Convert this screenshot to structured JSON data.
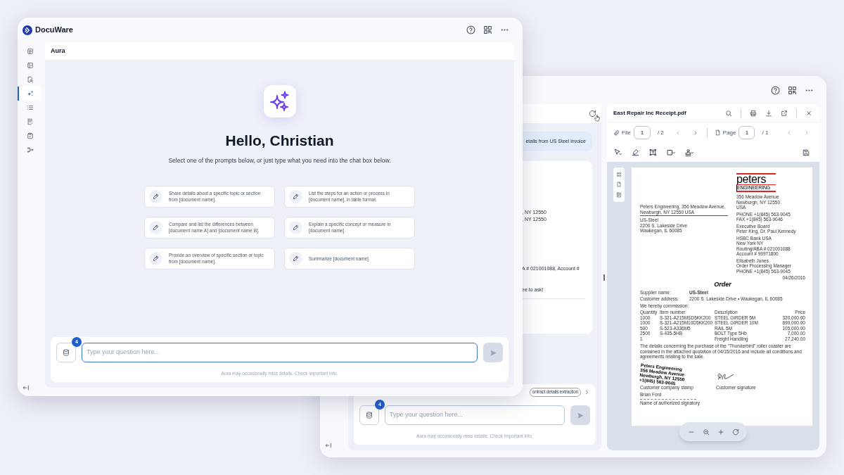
{
  "front_window": {
    "app_name": "DocuWare",
    "sidebar": {
      "items": [
        {
          "selected": false
        },
        {
          "selected": false
        },
        {
          "selected": false
        },
        {
          "selected": true
        },
        {
          "selected": false
        },
        {
          "selected": false
        },
        {
          "selected": false
        },
        {
          "selected": false
        }
      ]
    },
    "panel_title": "Aura",
    "greeting": "Hello, Christian",
    "subtitle": "Select one of the prompts below, or just type what you need into the chat box below.",
    "prompts": [
      "Share details about a specific topic or section from [document name].",
      "List the steps for an action or process in [document name], in table format.",
      "Compare and list the differences between [document name A] and [document name B].",
      "Explain a specific concept or measure in [document name].",
      "Provide an overview of specific section or topic from [document name].",
      "Summarize [document name]."
    ],
    "sources_count": "4",
    "chat_input": {
      "placeholder": "Type your question here..."
    },
    "disclaimer": "Aura may occasionally miss details. Check important info."
  },
  "back_window": {
    "user_message": "etails from US Steel invoice",
    "reply_lines": [
      ", NY 12550",
      ", NY 12550",
      "A # 021001088, Account #",
      "ee to ask!"
    ],
    "prompt_chip": "ontract details extraction",
    "sources_count": "4",
    "chat_input": {
      "placeholder": "Type your question here..."
    },
    "disclaimer": "Aura may occasionally miss details. Check important info.",
    "viewer": {
      "file_name": "East Repair Inc Receipt.pdf",
      "file_label": "File",
      "file_number": "1",
      "file_total": "/ 2",
      "page_label": "Page",
      "page_number": "1",
      "page_total": "/ 1"
    },
    "document": {
      "logo_top": "peters",
      "logo_bottom": "ENGINEERING",
      "letterhead_groups": [
        [
          "356 Meadow Avenue",
          "Newburgh, NY 12550",
          "USA"
        ],
        [
          "PHONE +1(845) 563-9045",
          "FAX +1(845) 563-9046"
        ],
        [
          "Executive Board",
          "Peter King, Dr. Paul Kennedy"
        ],
        [
          "HSBC Bank USA",
          "New York NY",
          "Routing/ABA # 021001088",
          "Account # 99971800"
        ],
        [
          "Elisabeth Jones",
          "Order Processing Manager",
          "PHONE +1(845) 563-9045"
        ]
      ],
      "sender_line": "Peters Engineering, 356 Meadow Avenue, Newburgh, NY 12550 USA",
      "recipient_lines": [
        "US-Steel",
        "2200 S. Lakeside Drive",
        "Waukegan, IL 60085"
      ],
      "date": "04/26/2016",
      "title": "Order",
      "fields": [
        {
          "label": "Supplier name:",
          "value": "US-Steel"
        },
        {
          "label": "Customer address:",
          "value": "2200 S. Lakeside Drive • Waukegan, IL 60085"
        }
      ],
      "commission_intro": "We hereby commission:",
      "table": {
        "columns": [
          "Quantity",
          "Item number",
          "Description",
          "Price"
        ],
        "rows": [
          [
            "1000",
            "S-321-A215MSD5KK200",
            "STEEL GIRDER 5M",
            "320,000.00"
          ],
          [
            "1000",
            "S-321-A215M10D5KK200",
            "STEEL GIRDER 10M",
            "690,000.00"
          ],
          [
            "500",
            "S-523-A336M5",
            "RAIL 5M",
            "105,000.00"
          ],
          [
            "2500",
            "S-435-5HB",
            "BOLT Type 5Hb",
            "7,000.00"
          ],
          [
            "1",
            "",
            "Freight Handling",
            "27,240.00"
          ]
        ]
      },
      "paragraph": "The details concerning the purchase of the \"Thunderbird\" roller coaster are contained in the attached quotation of 04/15/2016 and include all conditions and agreements relating to the sale.",
      "stamp_lines": [
        "Peters Engineering",
        "356 Meadow Avenue",
        "Newburgh, NY 12550",
        "+1(845) 563-9045"
      ],
      "stamp_label": "Customer company stamp",
      "signature_label": "Customer signature",
      "signatory_name": "Brian Ford",
      "signatory_label": "Name of authorized signatory"
    }
  }
}
